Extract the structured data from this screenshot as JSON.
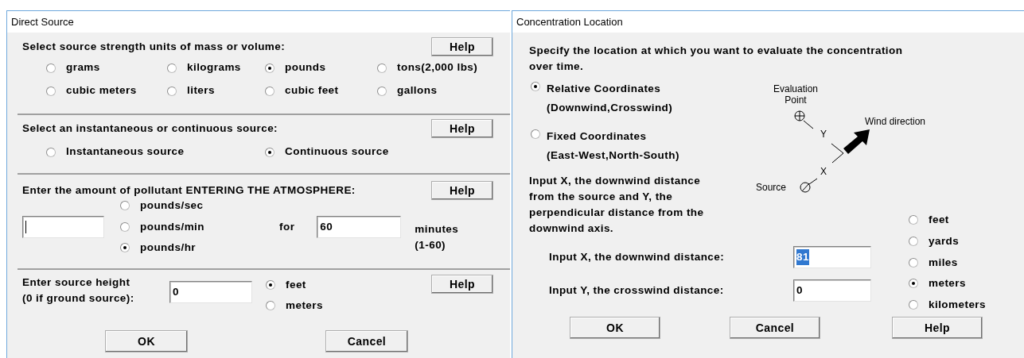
{
  "direct_source": {
    "title": "Direct Source",
    "units_section": {
      "prompt": "Select source strength units of mass or volume:",
      "help": "Help",
      "options": [
        {
          "label": "grams",
          "selected": false
        },
        {
          "label": "kilograms",
          "selected": false
        },
        {
          "label": "pounds",
          "selected": true
        },
        {
          "label": "tons(2,000 lbs)",
          "selected": false
        },
        {
          "label": "cubic meters",
          "selected": false
        },
        {
          "label": "liters",
          "selected": false
        },
        {
          "label": "cubic feet",
          "selected": false
        },
        {
          "label": "gallons",
          "selected": false
        }
      ]
    },
    "source_type_section": {
      "prompt": "Select an instantaneous or continuous source:",
      "help": "Help",
      "options": [
        {
          "label": "Instantaneous source",
          "selected": false
        },
        {
          "label": "Continuous source",
          "selected": true
        }
      ]
    },
    "amount_section": {
      "prompt": "Enter the amount of pollutant ENTERING THE ATMOSPHERE:",
      "help": "Help",
      "amount_focused": true,
      "rate_options": [
        {
          "label": "pounds/sec",
          "selected": false
        },
        {
          "label": "pounds/min",
          "selected": false
        },
        {
          "label": "pounds/hr",
          "selected": true
        }
      ],
      "for_label": "for",
      "duration_value": "60",
      "duration_unit": "minutes",
      "duration_range": "(1-60)"
    },
    "height_section": {
      "prompt_lines": [
        "Enter source height",
        "(0 if ground source):"
      ],
      "value": "0",
      "help": "Help",
      "unit_options": [
        {
          "label": "feet",
          "selected": true
        },
        {
          "label": "meters",
          "selected": false
        }
      ]
    },
    "buttons": [
      "OK",
      "Cancel"
    ]
  },
  "concentration_location": {
    "title": "Concentration Location",
    "instruction": "Specify the location at which you want to evaluate the concentration over time.",
    "coordinate_options": [
      {
        "label": "Relative Coordinates",
        "detail": "(Downwind,Crosswind)",
        "selected": true
      },
      {
        "label": "Fixed Coordinates",
        "detail": "(East-West,North-South)",
        "selected": false
      }
    ],
    "input_note": "Input X, the downwind distance from the source and Y, the perpendicular distance from the downwind axis.",
    "diagram": {
      "evaluation_label": "Evaluation Point",
      "wind_label": "Wind direction",
      "y_label": "Y",
      "x_label": "X",
      "source_label": "Source"
    },
    "x_input": {
      "label": "Input X, the downwind distance:",
      "value": "81",
      "text_selected": true
    },
    "y_input": {
      "label": "Input Y, the crosswind distance:",
      "value": "0",
      "text_selected": false
    },
    "unit_options": [
      {
        "label": "feet",
        "selected": false
      },
      {
        "label": "yards",
        "selected": false
      },
      {
        "label": "miles",
        "selected": false
      },
      {
        "label": "meters",
        "selected": true
      },
      {
        "label": "kilometers",
        "selected": false
      }
    ],
    "buttons": [
      "OK",
      "Cancel",
      "Help"
    ]
  }
}
